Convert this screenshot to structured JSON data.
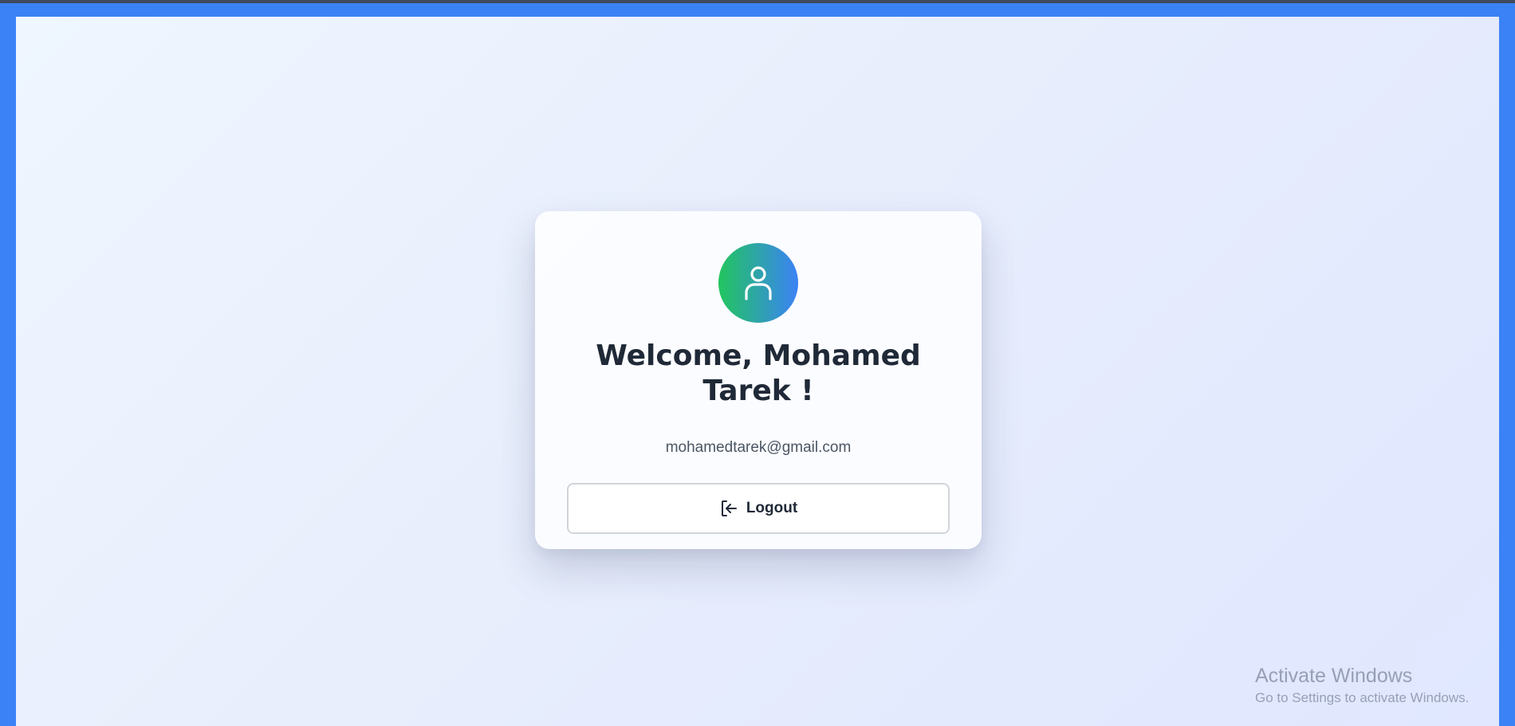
{
  "app": {
    "accent": "#3b82f6",
    "avatar_gradient": [
      "#22c55e",
      "#3b82f6"
    ]
  },
  "profile": {
    "avatar_icon": "user-icon",
    "welcome_text": "Welcome, Mohamed Tarek !",
    "email": "mohamedtarek@gmail.com"
  },
  "actions": {
    "logout_icon": "logout-icon",
    "logout_label": "Logout"
  },
  "watermark": {
    "title": "Activate Windows",
    "subtitle": "Go to Settings to activate Windows."
  }
}
